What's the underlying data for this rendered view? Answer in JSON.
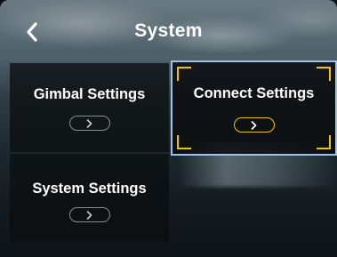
{
  "header": {
    "title": "System",
    "back_icon": "chevron-left-icon"
  },
  "tiles": [
    {
      "label": "Gimbal Settings",
      "icon": "chevron-right-icon",
      "selected": false
    },
    {
      "label": "Connect Settings",
      "icon": "chevron-right-icon",
      "selected": true
    },
    {
      "label": "System Settings",
      "icon": "chevron-right-icon",
      "selected": false
    }
  ],
  "colors": {
    "accent": "#f3c200",
    "selection_border": "#9ec2e8",
    "text": "#ffffff",
    "pill_inactive": "#8a8e92"
  }
}
